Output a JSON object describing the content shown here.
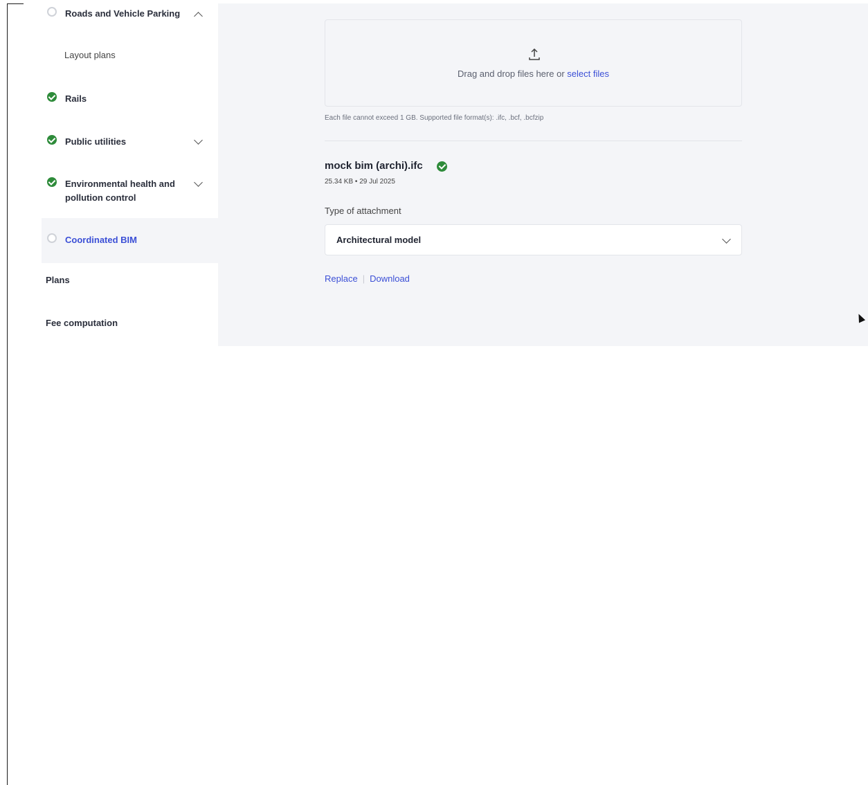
{
  "sidebar": {
    "items": [
      {
        "label": "Roads and Vehicle Parking",
        "status": "pending",
        "expanded": true
      },
      {
        "label": "Rails",
        "status": "done"
      },
      {
        "label": "Public utilities",
        "status": "done",
        "expanded": false
      },
      {
        "label": "Environmental health and pollution control",
        "status": "done",
        "expanded": false
      },
      {
        "label": "Coordinated BIM",
        "status": "pending",
        "active": true
      }
    ],
    "subitems": [
      "Layout plans"
    ],
    "sections": [
      "Plans",
      "Fee computation"
    ]
  },
  "upload": {
    "drop_text": "Drag and drop files here or",
    "select_link": "select files",
    "hint": "Each file cannot exceed 1 GB. Supported file format(s): .ifc, .bcf, .bcfzip"
  },
  "file": {
    "name": "mock bim (archi).ifc",
    "meta": "25.34 KB • 29 Jul 2025",
    "attachment_label": "Type of attachment",
    "attachment_value": "Architectural model",
    "replace_label": "Replace",
    "download_label": "Download"
  },
  "colors": {
    "accent": "#3b4fd6",
    "success": "#2e8b3a",
    "panel_bg": "#f4f5f8"
  }
}
